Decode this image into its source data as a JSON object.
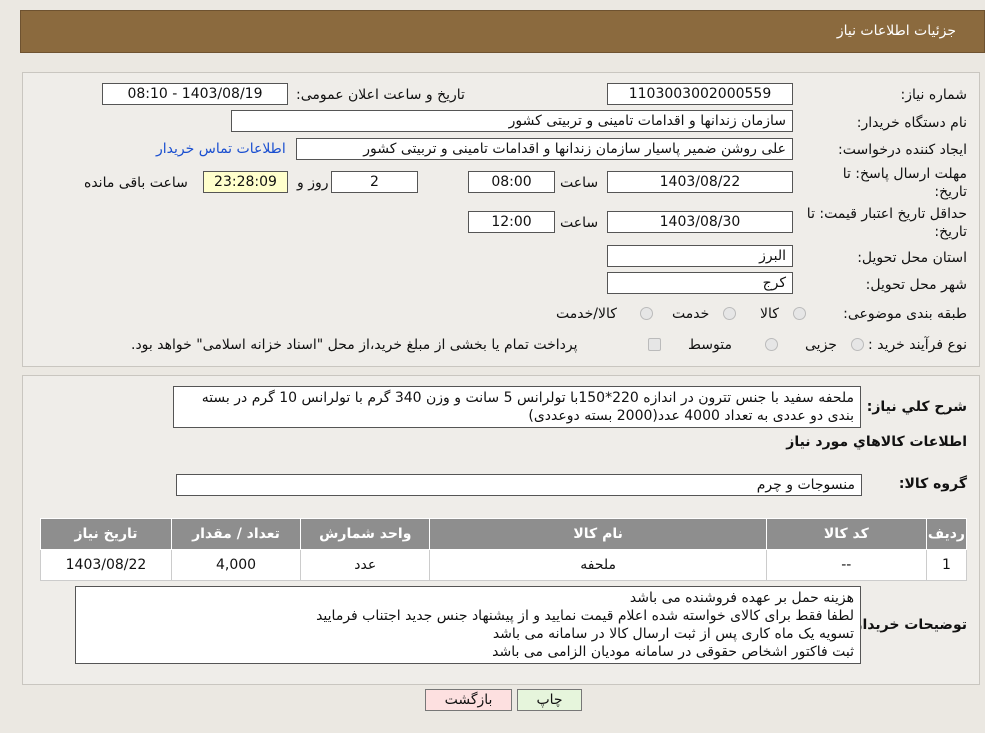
{
  "header": {
    "title": "جزئیات اطلاعات نیاز"
  },
  "fields": {
    "need_number_label": "شماره نیاز:",
    "need_number": "1103003002000559",
    "announce_label": "تاریخ و ساعت اعلان عمومی:",
    "announce_value": "1403/08/19 - 08:10",
    "buyer_label": "نام دستگاه خریدار:",
    "buyer_value": "سازمان زندانها و اقدامات تامینی و تربیتی کشور",
    "creator_label": "ایجاد کننده درخواست:",
    "creator_value": "علی روشن ضمیر پاسیار سازمان زندانها و اقدامات تامینی و تربیتی کشور",
    "contact_link": "اطلاعات تماس خریدار",
    "deadline_label_1": "مهلت ارسال پاسخ: تا",
    "deadline_label_2": "تاریخ:",
    "deadline_date": "1403/08/22",
    "time_label": "ساعت",
    "deadline_time": "08:00",
    "days_value": "2",
    "days_label": "روز و",
    "remaining_time": "23:28:09",
    "remaining_label": "ساعت باقی مانده",
    "validity_label_1": "حداقل تاریخ اعتبار قیمت: تا",
    "validity_label_2": "تاریخ:",
    "validity_date": "1403/08/30",
    "validity_time": "12:00",
    "province_label": "استان محل تحویل:",
    "province_value": "البرز",
    "city_label": "شهر محل تحویل:",
    "city_value": "کرج",
    "category_label": "طبقه بندی موضوعی:",
    "category_options": [
      "کالا",
      "خدمت",
      "کالا/خدمت"
    ],
    "process_label": "نوع فرآیند خرید :",
    "process_options": [
      "جزیی",
      "متوسط"
    ],
    "process_note": "پرداخت تمام یا بخشی از مبلغ خرید،از محل \"اسناد خزانه اسلامی\" خواهد بود."
  },
  "summary": {
    "label": "شرح کلي نياز:",
    "text_line1": "ملحفه سفید با جنس تترون در اندازه 220*150با تولرانس 5 سانت و وزن 340 گرم با تولرانس 10 گرم در بسته",
    "text_line2": "بندی دو عددی به تعداد 4000 عدد(2000 بسته دوعددی)",
    "goods_info_title": "اطلاعات کالاهاي مورد نياز",
    "group_label": "گروه کالا:",
    "group_value": "منسوجات و چرم"
  },
  "table": {
    "headers": [
      "رديف",
      "کد کالا",
      "نام کالا",
      "واحد شمارش",
      "تعداد / مقدار",
      "تاریخ نیاز"
    ],
    "rows": [
      [
        "1",
        "--",
        "ملحفه",
        "عدد",
        "4,000",
        "1403/08/22"
      ]
    ]
  },
  "notes": {
    "label": "توضیحات خریدار:",
    "lines": [
      "هزینه حمل بر عهده فروشنده می باشد",
      "لطفا فقط برای کالای خواسته شده اعلام قیمت نمایید و از پیشنهاد جنس جدید اجتناب فرمایید",
      "تسویه یک ماه کاری پس از ثبت ارسال کالا در سامانه می باشد",
      "ثبت فاکتور اشخاص حقوقی در سامانه مودیان الزامی می باشد"
    ]
  },
  "buttons": {
    "print": "چاپ",
    "back": "بازگشت"
  },
  "colors": {
    "header_bg": "#8b6a3e",
    "back_button_bg": "#fde0e0",
    "print_button_bg": "#e6f5dc",
    "remaining_bg": "#ffffcc"
  }
}
